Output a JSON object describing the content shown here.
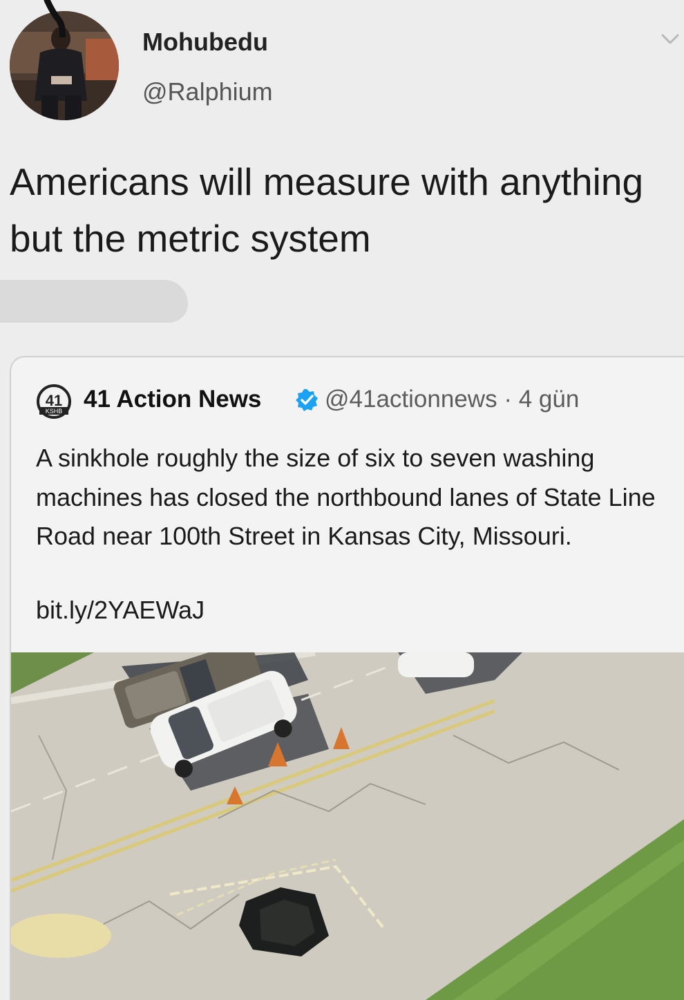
{
  "user": {
    "display_name": "Mohubedu",
    "handle": "@Ralphium"
  },
  "tweet": {
    "text": "Americans will measure with anything but the metric system"
  },
  "quoted_tweet": {
    "logo_text": "41",
    "logo_subtext": "KSHB",
    "name": "41 Action News",
    "handle": "@41actionnews",
    "separator": "·",
    "time": "4 gün",
    "text": "A sinkhole roughly the size of six to seven washing machines has closed the northbound lanes of State Line Road near 100th Street in Kansas City, Missouri.",
    "link": "bit.ly/2YAEWaJ"
  },
  "colors": {
    "background": "#ededed",
    "verified_badge": "#1da1f2",
    "grass": "#6f9a45",
    "road": "#cfcbc0"
  },
  "icons": {
    "menu": "chevron-down-icon",
    "verified": "verified-badge-icon"
  }
}
